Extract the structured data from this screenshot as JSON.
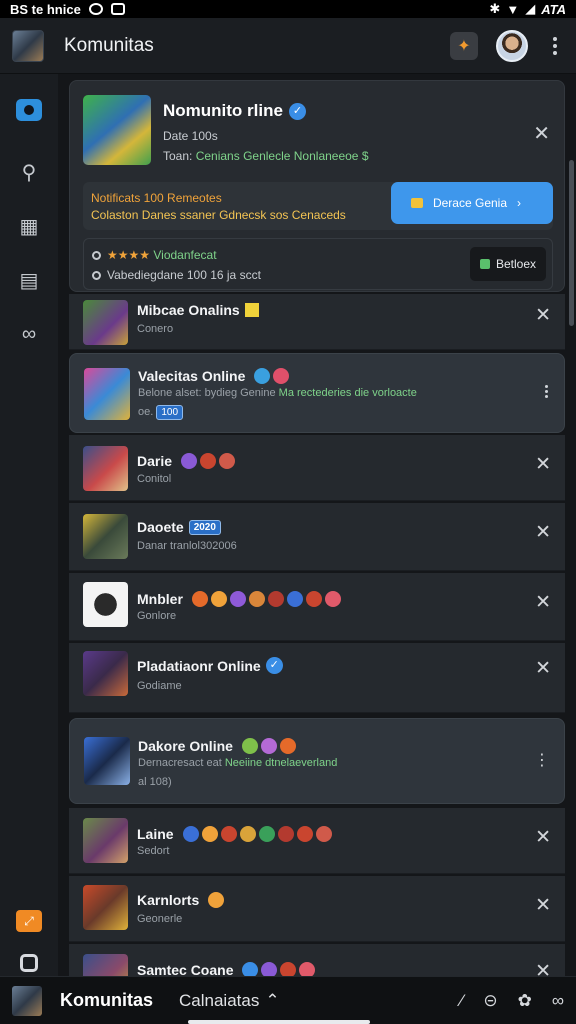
{
  "status_bar": {
    "left_text": "BS te hnice",
    "right_text": "ATA"
  },
  "header": {
    "title": "Komunitas"
  },
  "featured": {
    "title": "Nomunito rline",
    "subtitle1": "Date 100s",
    "subtitle2_prefix": "Toan:",
    "subtitle2_green": "Cenians Genlecle Nonlaneeoe",
    "notice_line1": "Notificats 100 Remeotes",
    "notice_line2": "Colaston Danes ssaner Gdnecsk sos Cenaceds",
    "donate_label": "Derace Genia",
    "rating_text": "Viodanfecat",
    "info_line": "Vabediegdane 100 16 ja scct",
    "action_label": "Betloex"
  },
  "rows": [
    {
      "title": "Mibcae Onalins",
      "sub": "Conero",
      "action": "close",
      "emojis": []
    },
    {
      "title": "Valecitas Online",
      "sub": "Belone alset: bydieg Genine",
      "sub_green": "Ma rectederies die vorloacte",
      "sub2": "oe.",
      "tag": "100",
      "action": "more",
      "emojis": [
        "#3aa0e0",
        "#e0506a"
      ]
    },
    {
      "title": "Darie",
      "sub": "Conitol",
      "action": "close",
      "emojis": [
        "#8a5ad6",
        "#c9452f",
        "#d05a4a"
      ]
    },
    {
      "title": "Daoete",
      "sub": "Danar tranlol302006",
      "tag": "2020",
      "action": "close",
      "emojis": []
    },
    {
      "title": "Mnbler",
      "sub": "Gonlore",
      "action": "close",
      "emojis": [
        "#e56a2a",
        "#f0a23a",
        "#8f5ad8",
        "#d9863a",
        "#b33a2f",
        "#3a6fd6",
        "#c9452f",
        "#e05a6a"
      ]
    },
    {
      "title": "Pladatiaonr Online",
      "sub": "Godiame",
      "action": "close",
      "emojis": [
        "#3a8ee6"
      ]
    },
    {
      "title": "Dakore Online",
      "sub": "Dernacresact eat",
      "sub_green": "Neeiine dtnelaeverland",
      "sub2": "al 108)",
      "action": "more",
      "emojis": [
        "#7fc04a",
        "#b46ad6",
        "#e56a2a"
      ]
    },
    {
      "title": "Laine",
      "sub": "Sedort",
      "action": "close",
      "emojis": [
        "#3a6fd6",
        "#f0a23a",
        "#c9452f",
        "#d9a33a",
        "#3aa05a",
        "#b33a2f",
        "#c9452f",
        "#d05a4a",
        "#c9452f",
        "#e05a6a"
      ]
    },
    {
      "title": "Karnlorts",
      "sub": "Geonerle",
      "action": "close",
      "emojis": [
        "#f0a23a"
      ]
    },
    {
      "title": "Samtec Coane",
      "sub": "",
      "action": "close",
      "emojis": [
        "#3a8ee6",
        "#8a5ad6",
        "#c9452f",
        "#e05a6a"
      ]
    }
  ],
  "bottom_bar": {
    "title": "Komunitas",
    "subtitle": "Calnaiatas"
  }
}
